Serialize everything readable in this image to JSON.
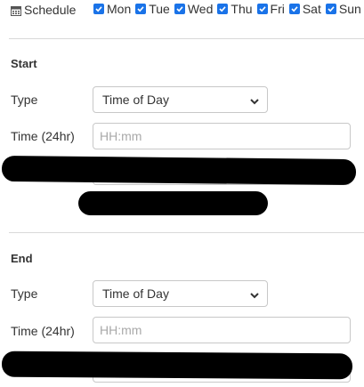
{
  "schedule": {
    "label": "Schedule",
    "days": [
      {
        "label": "Mon",
        "checked": true
      },
      {
        "label": "Tue",
        "checked": true
      },
      {
        "label": "Wed",
        "checked": true
      },
      {
        "label": "Thu",
        "checked": true
      },
      {
        "label": "Fri",
        "checked": true
      },
      {
        "label": "Sat",
        "checked": true
      },
      {
        "label": "Sun",
        "checked": true
      }
    ]
  },
  "start": {
    "title": "Start",
    "type_label": "Type",
    "type_value": "Time of Day",
    "time_label": "Time (24hr)",
    "time_placeholder": "HH:mm"
  },
  "end": {
    "title": "End",
    "type_label": "Type",
    "type_value": "Time of Day",
    "time_label": "Time (24hr)",
    "time_placeholder": "HH:mm"
  },
  "colors": {
    "checkbox": "#1a73e8",
    "divider": "#d9d9d9",
    "redaction": "#000000"
  }
}
